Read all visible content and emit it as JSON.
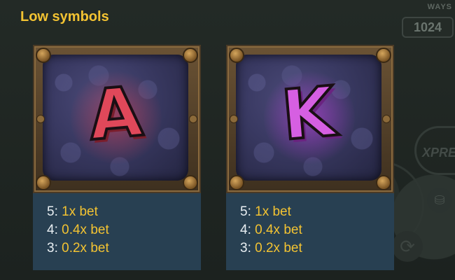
{
  "header": {
    "title": "Low symbols"
  },
  "background": {
    "ways_label": "WAYS",
    "ways_value": "1024",
    "xpress_label": "XPRE"
  },
  "symbols": [
    {
      "letter": "A",
      "accent_color": "#e0485a",
      "payouts": [
        {
          "count": "5:",
          "value": "1x bet"
        },
        {
          "count": "4:",
          "value": "0.4x bet"
        },
        {
          "count": "3:",
          "value": "0.2x bet"
        }
      ]
    },
    {
      "letter": "K",
      "accent_color": "#d65fe2",
      "payouts": [
        {
          "count": "5:",
          "value": "1x bet"
        },
        {
          "count": "4:",
          "value": "0.4x bet"
        },
        {
          "count": "3:",
          "value": "0.2x bet"
        }
      ]
    }
  ],
  "colors": {
    "title": "#f3c332",
    "panel": "#284052",
    "value": "#f3c332",
    "count": "#e8eef2"
  }
}
